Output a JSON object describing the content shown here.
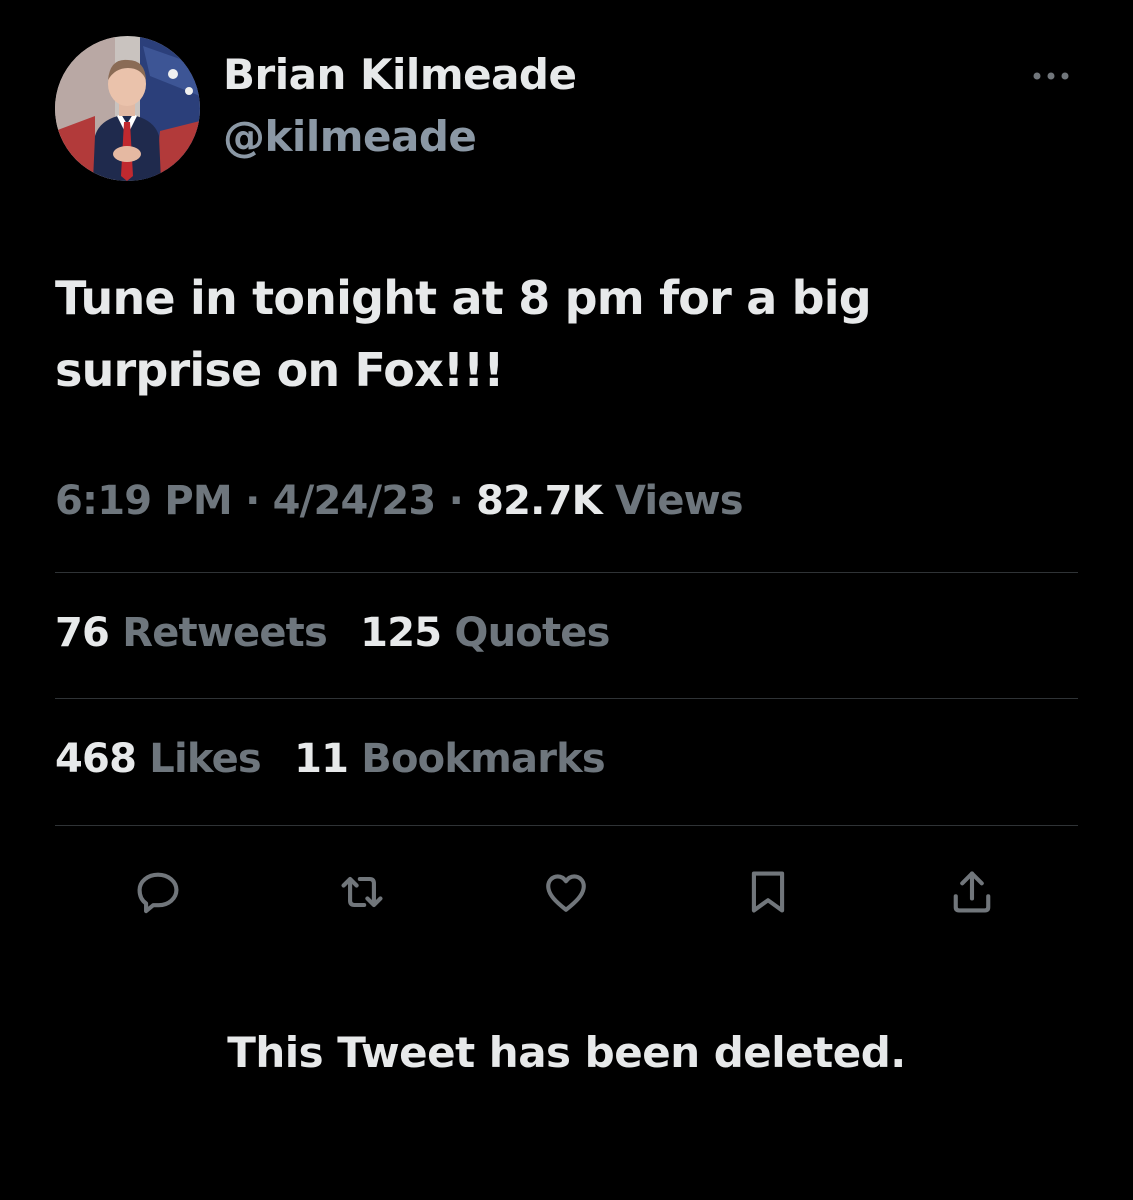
{
  "author": {
    "display_name": "Brian Kilmeade",
    "handle": "@kilmeade"
  },
  "tweet": {
    "text": "Tune in tonight at 8 pm for a big surprise on Fox!!!",
    "time": "6:19 PM",
    "separator": "·",
    "date": "4/24/23",
    "views_count": "82.7K",
    "views_label": "Views"
  },
  "stats": {
    "retweets_count": "76",
    "retweets_label": "Retweets",
    "quotes_count": "125",
    "quotes_label": "Quotes",
    "likes_count": "468",
    "likes_label": "Likes",
    "bookmarks_count": "11",
    "bookmarks_label": "Bookmarks"
  },
  "icons": {
    "more": "more-horizontal-icon",
    "reply": "reply-icon",
    "retweet": "retweet-icon",
    "like": "heart-icon",
    "bookmark": "bookmark-icon",
    "share": "share-icon"
  },
  "colors": {
    "background": "#000000",
    "primary_text": "#e7e9ea",
    "secondary_text": "#6e767d",
    "handle_text": "#8b98a5",
    "icon": "#71767b",
    "divider": "#2f3336"
  },
  "notice": "This Tweet has been deleted."
}
